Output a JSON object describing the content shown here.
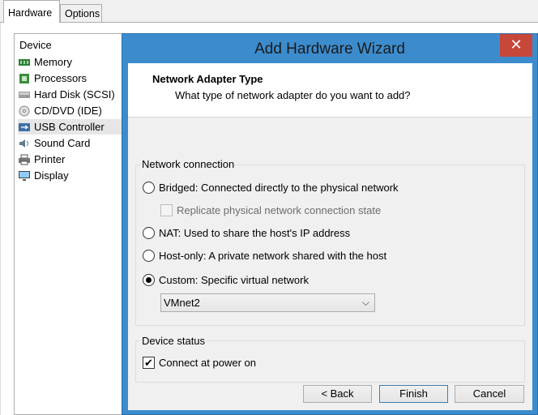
{
  "parent": {
    "tabs": [
      {
        "label": "Hardware",
        "active": true
      },
      {
        "label": "Options",
        "active": false
      }
    ],
    "device_header": "Device",
    "devices": [
      {
        "label": "Memory",
        "icon": "memory-icon"
      },
      {
        "label": "Processors",
        "icon": "processor-icon"
      },
      {
        "label": "Hard Disk (SCSI)",
        "icon": "hard-disk-icon"
      },
      {
        "label": "CD/DVD (IDE)",
        "icon": "cd-dvd-icon"
      },
      {
        "label": "USB Controller",
        "icon": "usb-icon",
        "selected": true
      },
      {
        "label": "Sound Card",
        "icon": "sound-card-icon"
      },
      {
        "label": "Printer",
        "icon": "printer-icon"
      },
      {
        "label": "Display",
        "icon": "display-icon"
      }
    ]
  },
  "wizard": {
    "title": "Add Hardware Wizard",
    "close_label": "✕",
    "header_title": "Network Adapter Type",
    "header_subtitle": "What type of network adapter do you want to add?",
    "network_group_label": "Network connection",
    "options": {
      "bridged": "Bridged: Connected directly to the physical network",
      "replicate": "Replicate physical network connection state",
      "nat": "NAT: Used to share the host's IP address",
      "hostonly": "Host-only: A private network shared with the host",
      "custom": "Custom: Specific virtual network"
    },
    "selected_option": "custom",
    "vmnet_value": "VMnet2",
    "status_group_label": "Device status",
    "connect_label": "Connect at power on",
    "connect_checked": true,
    "buttons": {
      "back": "< Back",
      "finish": "Finish",
      "cancel": "Cancel"
    }
  },
  "colors": {
    "wizard_frame": "#3c8ccd",
    "close_button": "#c7473a",
    "selected_row": "#e6e6e6"
  }
}
